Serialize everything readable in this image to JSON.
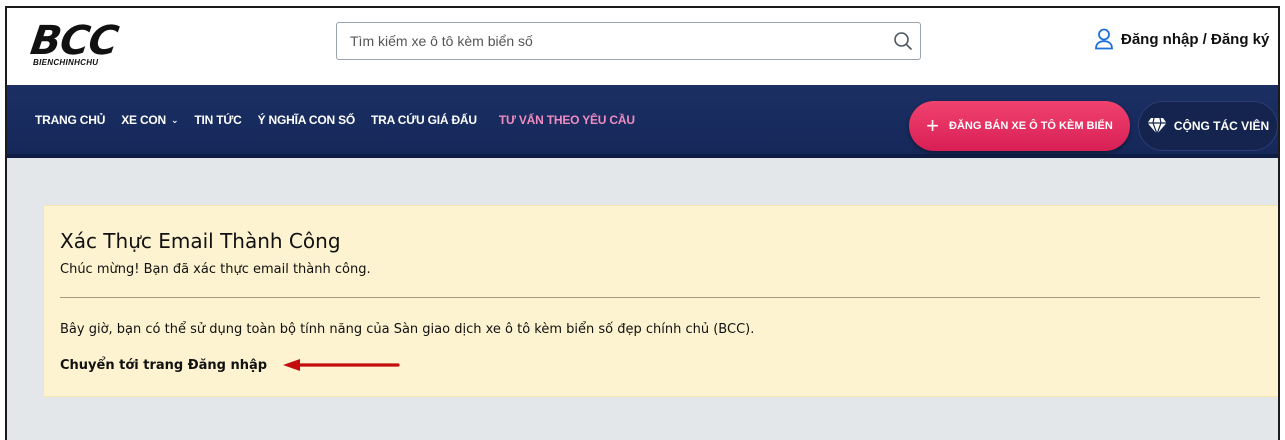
{
  "header": {
    "logo_text": "BCC",
    "logo_subtext": "BIENCHINHCHU",
    "search_placeholder": "Tìm kiếm xe ô tô kèm biển số",
    "login_label": "Đăng nhập / Đăng ký"
  },
  "nav": {
    "items": [
      {
        "label": "TRANG CHỦ"
      },
      {
        "label": "XE CON"
      },
      {
        "label": "TIN TỨC"
      },
      {
        "label": "Ý NGHĨA CON SỐ"
      },
      {
        "label": "TRA CỨU GIÁ ĐẤU"
      },
      {
        "label": "TƯ VẤN THEO YÊU CẦU"
      }
    ],
    "post_button": "ĐĂNG BÁN XE Ô TÔ KÈM BIỂN",
    "ctv_button": "CỘNG TÁC VIÊN"
  },
  "colors": {
    "nav_bg": "#1b2f63",
    "accent_pink": "#e22c5f",
    "alert_bg": "#fdf3d0",
    "arrow_red": "#c40e0e"
  },
  "main": {
    "title": "Xác Thực Email Thành Công",
    "subtitle": "Chúc mừng! Bạn đã xác thực email thành công.",
    "body": "Bây giờ, bạn có thể sử dụng toàn bộ tính năng của Sàn giao dịch xe ô tô kèm biển số đẹp chính chủ (BCC).",
    "login_link": "Chuyển tới trang Đăng nhập"
  }
}
